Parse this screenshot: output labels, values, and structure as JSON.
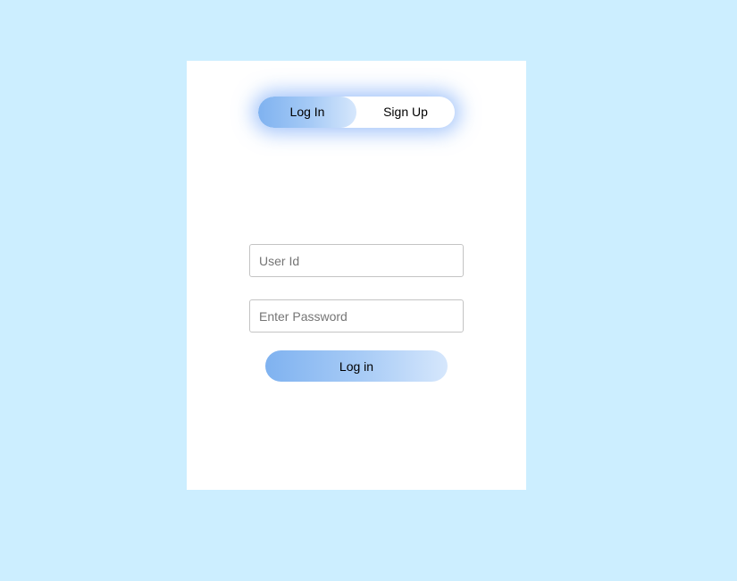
{
  "toggle": {
    "login_label": "Log In",
    "signup_label": "Sign Up",
    "active": "login"
  },
  "form": {
    "user_placeholder": "User Id",
    "user_value": "",
    "password_placeholder": "Enter Password",
    "password_value": "",
    "submit_label": "Log in"
  },
  "colors": {
    "page_background": "#cceeff",
    "card_background": "#ffffff",
    "accent_gradient_start": "#7fb2f0",
    "accent_gradient_end": "#d6e7fc",
    "toggle_glow": "#5a96f5"
  }
}
